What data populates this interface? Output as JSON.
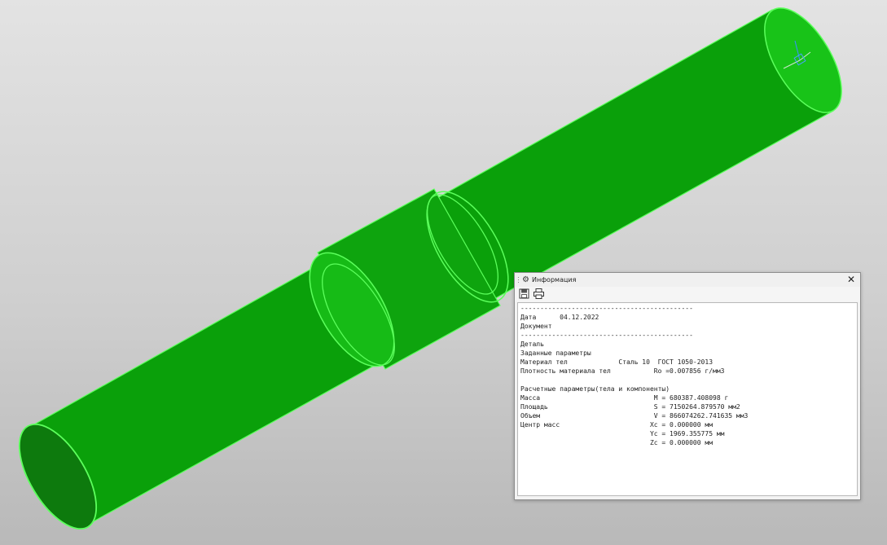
{
  "window": {
    "title": "Информация",
    "close_glyph": "✕",
    "title_icon": "gear-icon",
    "toolbar_icons": [
      "save-icon",
      "print-icon"
    ]
  },
  "report": {
    "lines": [
      "--------------------------------------------",
      "Дата      04.12.2022",
      "Документ",
      "--------------------------------------------",
      "Деталь",
      "Заданные параметры",
      "Материал тел             Сталь 10  ГОСТ 1050-2013",
      "Плотность материала тел           Ro =0.007856 г/мм3",
      "",
      "Расчетные параметры(тела и компоненты)",
      "Масса                             M = 680387.408098 г",
      "Площадь                           S = 7150264.879570 мм2",
      "Объем                             V = 866074262.741635 мм3",
      "Центр масс                       Xc = 0.000000 мм",
      "                                 Yc = 1969.355775 мм",
      "                                 Zc = 0.000000 мм"
    ]
  },
  "colors": {
    "model_green": "#17bf17",
    "edge_green": "#5cff5c",
    "dark_green": "#0d7a0d",
    "background": "#d4d4d4"
  }
}
